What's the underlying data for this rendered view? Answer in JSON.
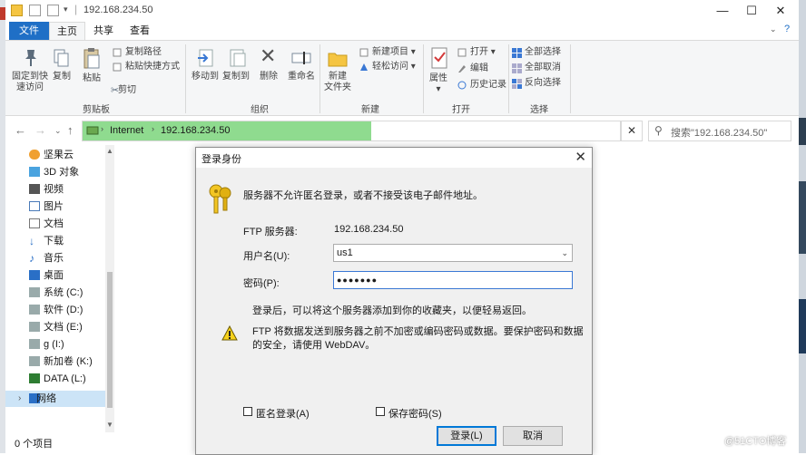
{
  "window": {
    "title": "192.168.234.50",
    "minimize": "—",
    "maximize": "☐",
    "close": "✕"
  },
  "tabs": {
    "file": "文件",
    "home": "主页",
    "share": "共享",
    "view": "查看"
  },
  "ribbon": {
    "pin": "固定到快\n速访问",
    "copy": "复制",
    "paste": "粘贴",
    "copy_path": "复制路径",
    "paste_shortcut": "粘贴快捷方式",
    "cut": "剪切",
    "clipboard_group": "剪贴板",
    "move_to": "移动到",
    "copy_to": "复制到",
    "delete": "删除",
    "rename": "重命名",
    "organize_group": "组织",
    "new_folder": "新建\n文件夹",
    "new_item": "新建项目",
    "easy_access": "轻松访问",
    "new_group": "新建",
    "properties": "属性",
    "open": "打开",
    "edit": "编辑",
    "history": "历史记录",
    "open_group": "打开",
    "select_all": "全部选择",
    "select_none": "全部取消",
    "invert_selection": "反向选择",
    "select_group": "选择"
  },
  "address": {
    "crumb1": "Internet",
    "crumb2": "192.168.234.50",
    "search_placeholder": "搜索\"192.168.234.50\""
  },
  "nav": {
    "items": [
      "坚果云",
      "3D 对象",
      "视频",
      "图片",
      "文档",
      "下载",
      "音乐",
      "桌面",
      "系统 (C:)",
      "软件 (D:)",
      "文档 (E:)",
      "g (I:)",
      "新加卷 (K:)",
      "DATA (L:)",
      "网络"
    ]
  },
  "status": {
    "count": "0 个项目"
  },
  "dialog": {
    "title": "登录身份",
    "message": "服务器不允许匿名登录，或者不接受该电子邮件地址。",
    "ftp_label": "FTP 服务器:",
    "ftp_value": "192.168.234.50",
    "user_label": "用户名(U):",
    "user_value": "us1",
    "pass_label": "密码(P):",
    "pass_value": "●●●●●●●",
    "info": "登录后，可以将这个服务器添加到你的收藏夹，以便轻易返回。",
    "warning": "FTP 将数据发送到服务器之前不加密或编码密码或数据。要保护密码和数据的安全，请使用 WebDAV。",
    "anonymous": "匿名登录(A)",
    "save_password": "保存密码(S)",
    "login": "登录(L)",
    "cancel": "取消"
  },
  "watermark": "@51CTO博客"
}
